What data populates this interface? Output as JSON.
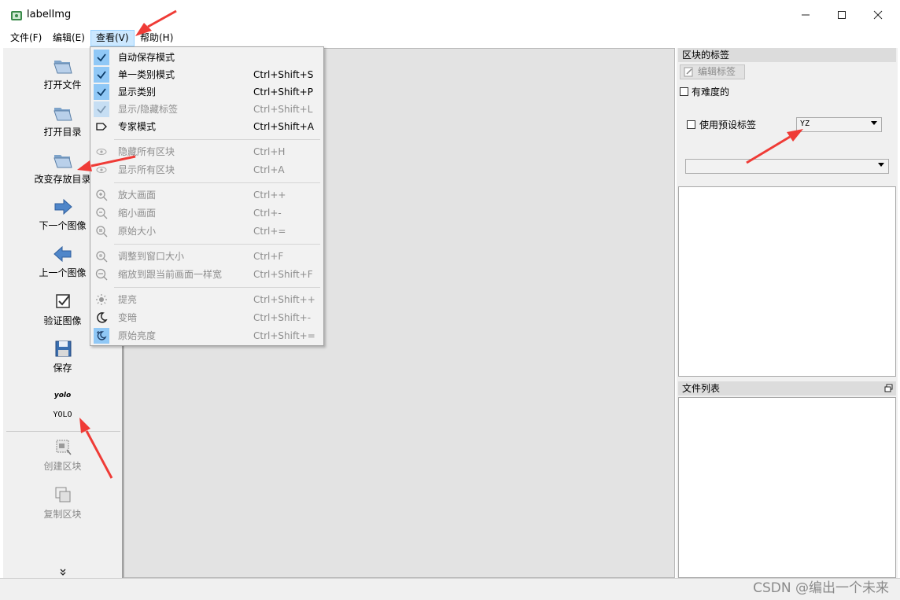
{
  "window": {
    "title": "labelImg",
    "minimize_icon": "minimize-icon",
    "maximize_icon": "maximize-icon",
    "close_icon": "close-icon"
  },
  "menubar": [
    {
      "label": "文件(F)"
    },
    {
      "label": "编辑(E)"
    },
    {
      "label": "查看(V)"
    },
    {
      "label": "帮助(H)"
    }
  ],
  "toolbar": [
    {
      "label": "打开文件",
      "icon": "folder-open-icon"
    },
    {
      "label": "打开目录",
      "icon": "folder-open-icon"
    },
    {
      "label": "改变存放目录",
      "icon": "folder-open-icon"
    },
    {
      "label": "下一个图像",
      "icon": "arrow-right-icon"
    },
    {
      "label": "上一个图像",
      "icon": "arrow-left-icon"
    },
    {
      "label": "验证图像",
      "icon": "checkbox-icon"
    },
    {
      "label": "保存",
      "icon": "floppy-disk-icon"
    },
    {
      "label": "YOLO",
      "icon_text": "yolo"
    },
    {
      "label": "创建区块",
      "icon": "create-box-icon"
    },
    {
      "label": "复制区块",
      "icon": "copy-box-icon"
    }
  ],
  "toolbar_more_icon": "double-chevron-down-icon",
  "view_menu": {
    "items": [
      {
        "label": "自动保存模式",
        "shortcut": "",
        "checked": true,
        "enabled": true
      },
      {
        "label": "单一类别模式",
        "shortcut": "Ctrl+Shift+S",
        "checked": true,
        "enabled": true
      },
      {
        "label": "显示类别",
        "shortcut": "Ctrl+Shift+P",
        "checked": true,
        "enabled": true
      },
      {
        "label": "显示/隐藏标签",
        "shortcut": "Ctrl+Shift+L",
        "checked": true,
        "enabled": false
      },
      {
        "label": "专家模式",
        "shortcut": "Ctrl+Shift+A",
        "checked": false,
        "enabled": true,
        "icon": "tag-icon"
      },
      {
        "label": "隐藏所有区块",
        "shortcut": "Ctrl+H",
        "enabled": false,
        "icon": "eye-icon"
      },
      {
        "label": "显示所有区块",
        "shortcut": "Ctrl+A",
        "enabled": false,
        "icon": "eye-icon"
      },
      {
        "label": "放大画面",
        "shortcut": "Ctrl++",
        "enabled": false,
        "icon": "zoom-in-icon"
      },
      {
        "label": "缩小画面",
        "shortcut": "Ctrl+-",
        "enabled": false,
        "icon": "zoom-out-icon"
      },
      {
        "label": "原始大小",
        "shortcut": "Ctrl+=",
        "enabled": false,
        "icon": "zoom-reset-icon"
      },
      {
        "label": "调整到窗口大小",
        "shortcut": "Ctrl+F",
        "enabled": false,
        "icon": "fit-window-icon"
      },
      {
        "label": "缩放到跟当前画面一样宽",
        "shortcut": "Ctrl+Shift+F",
        "enabled": false,
        "icon": "fit-width-icon"
      },
      {
        "label": "提亮",
        "shortcut": "Ctrl+Shift++",
        "enabled": false,
        "icon": "sun-icon"
      },
      {
        "label": "变暗",
        "shortcut": "Ctrl+Shift+-",
        "enabled": false,
        "icon": "moon-icon"
      },
      {
        "label": "原始亮度",
        "shortcut": "Ctrl+Shift+=",
        "enabled": false,
        "icon": "brightness-reset-icon"
      }
    ]
  },
  "right_panel": {
    "box_labels_title": "区块的标签",
    "edit_label_button": "编辑标签",
    "difficult_checkbox": "有难度的",
    "use_default_label": "使用预设标签",
    "default_label_value": "YZ",
    "file_list_title": "文件列表",
    "float_icon": "float-window-icon"
  },
  "watermark": "CSDN @编出一个未来"
}
